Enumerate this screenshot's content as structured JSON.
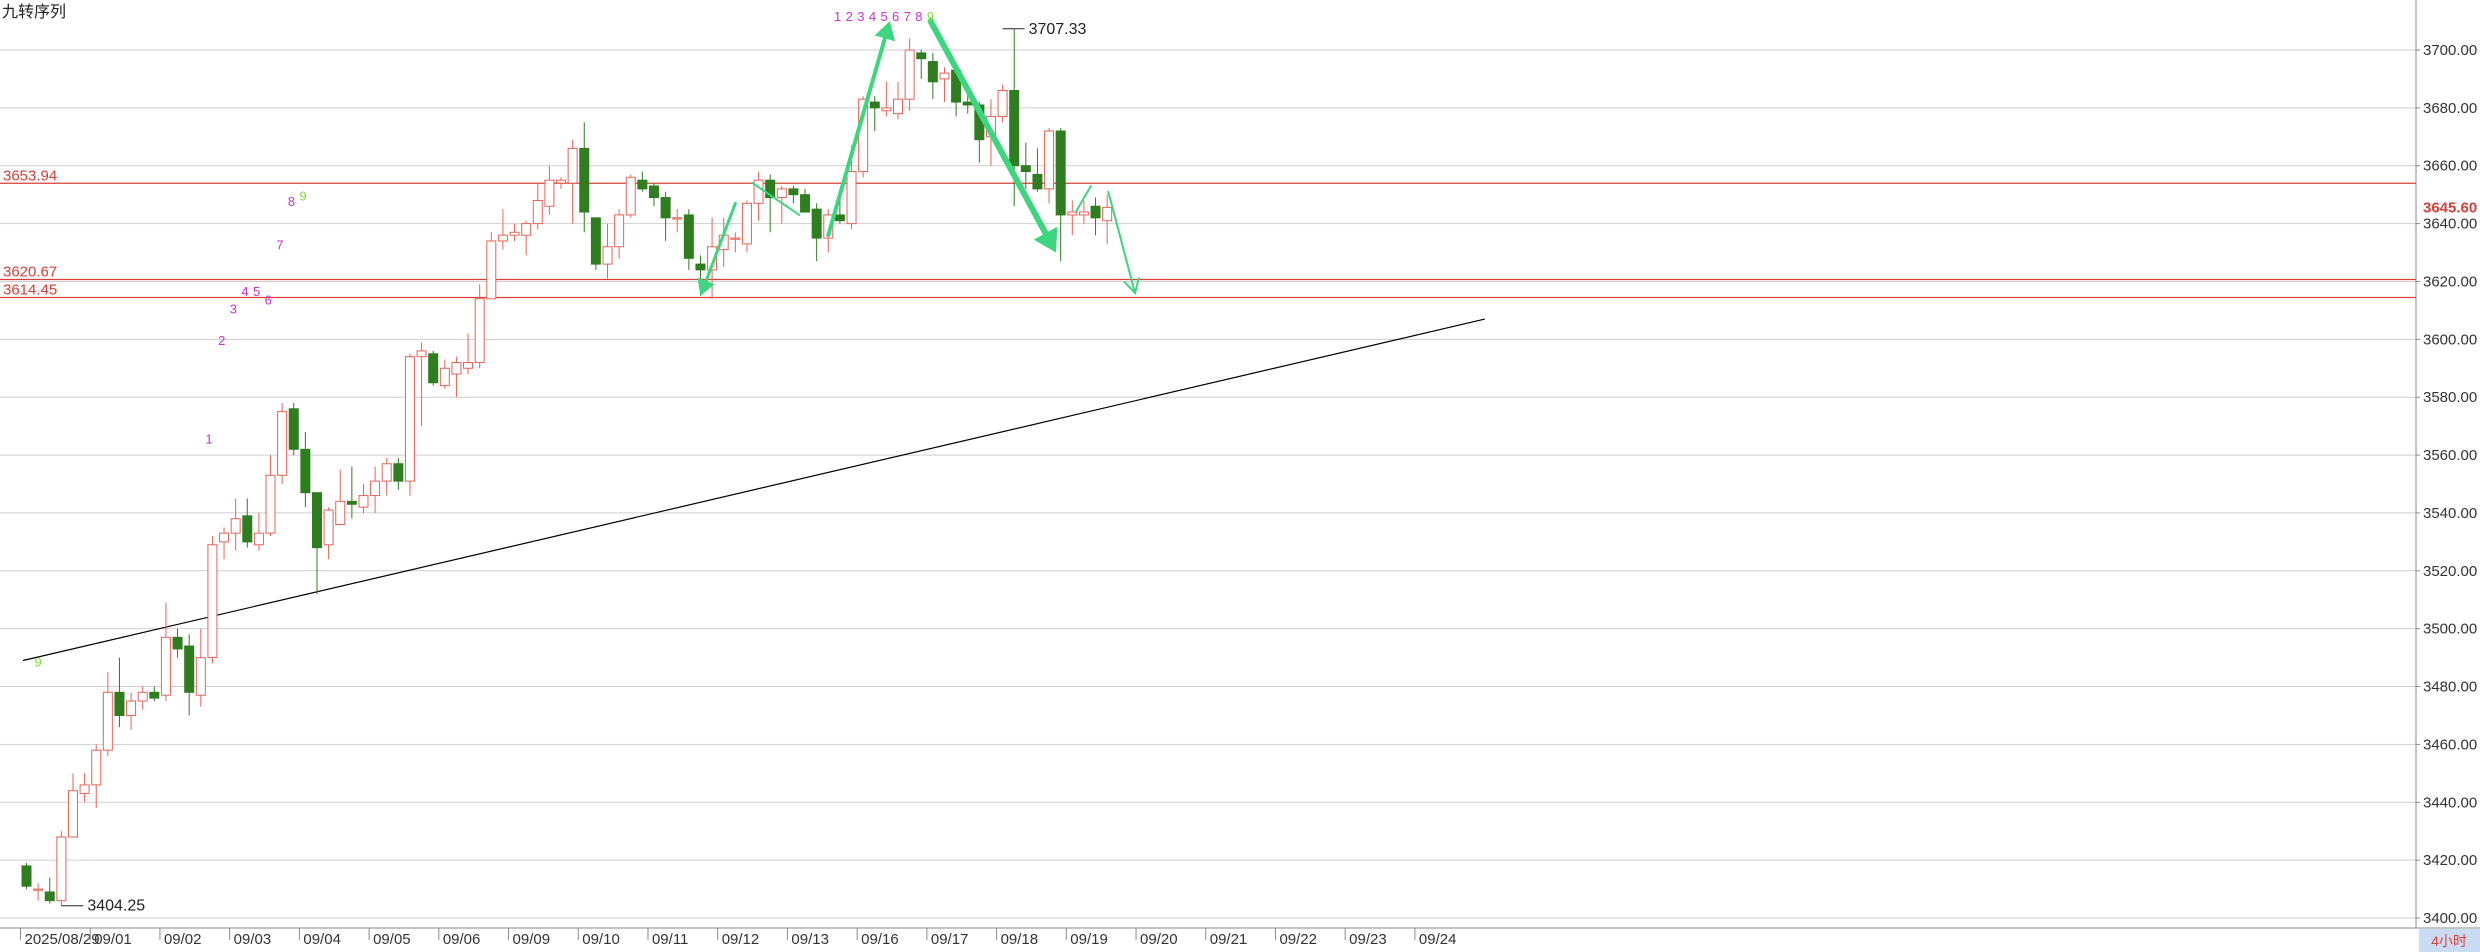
{
  "indicator_name": "九转序列",
  "colors": {
    "up": "#e8635a",
    "down": "#2e7d1f",
    "level_line": "#d9403a",
    "level_label": "#d9403a",
    "trend_line": "#000000",
    "arrow": "#3cd67f",
    "td_setup": "#cc33cc",
    "td_nine": "#7dde3a",
    "grid": "#cfcfcf",
    "axis_text": "#333333",
    "last_price_label": "#d9403a",
    "period_badge_bg": "#c9dcf3",
    "period_badge_text": "#d9403a"
  },
  "chart_data": {
    "type": "candlestick",
    "y_axis": {
      "min": 3400,
      "max": 3700,
      "ticks": [
        "3400.00",
        "3420.00",
        "3440.00",
        "3460.00",
        "3480.00",
        "3500.00",
        "3520.00",
        "3540.00",
        "3560.00",
        "3580.00",
        "3600.00",
        "3620.00",
        "3640.00",
        "3660.00",
        "3680.00",
        "3700.00"
      ]
    },
    "x_axis": {
      "labels": [
        {
          "text": "2025/08/29",
          "index": 0
        },
        {
          "text": "09/01",
          "index": 6
        },
        {
          "text": "09/02",
          "index": 12
        },
        {
          "text": "09/03",
          "index": 18
        },
        {
          "text": "09/04",
          "index": 24
        },
        {
          "text": "09/05",
          "index": 30
        },
        {
          "text": "09/06",
          "index": 36
        },
        {
          "text": "09/09",
          "index": 42
        },
        {
          "text": "09/10",
          "index": 48
        },
        {
          "text": "09/11",
          "index": 54
        },
        {
          "text": "09/12",
          "index": 60
        },
        {
          "text": "09/13",
          "index": 66
        },
        {
          "text": "09/16",
          "index": 72
        },
        {
          "text": "09/17",
          "index": 78
        },
        {
          "text": "09/18",
          "index": 84
        },
        {
          "text": "09/19",
          "index": 90
        },
        {
          "text": "09/20",
          "index": 96
        },
        {
          "text": "09/21",
          "index": 102
        },
        {
          "text": "09/22",
          "index": 108
        },
        {
          "text": "09/23",
          "index": 114
        },
        {
          "text": "09/24",
          "index": 120
        }
      ]
    },
    "candles": [
      {
        "o": 3418,
        "h": 3419,
        "l": 3410,
        "c": 3411
      },
      {
        "o": 3410,
        "h": 3412,
        "l": 3406,
        "c": 3410
      },
      {
        "o": 3409,
        "h": 3414,
        "l": 3405,
        "c": 3406
      },
      {
        "o": 3406,
        "h": 3430,
        "l": 3404.25,
        "c": 3428
      },
      {
        "o": 3428,
        "h": 3450,
        "l": 3428,
        "c": 3444
      },
      {
        "o": 3443,
        "h": 3450,
        "l": 3440,
        "c": 3446
      },
      {
        "o": 3446,
        "h": 3460,
        "l": 3438,
        "c": 3458
      },
      {
        "o": 3458,
        "h": 3485,
        "l": 3456,
        "c": 3478
      },
      {
        "o": 3478,
        "h": 3490,
        "l": 3466,
        "c": 3470
      },
      {
        "o": 3470,
        "h": 3478,
        "l": 3465,
        "c": 3475
      },
      {
        "o": 3475,
        "h": 3480,
        "l": 3472,
        "c": 3478
      },
      {
        "o": 3478,
        "h": 3480,
        "l": 3475,
        "c": 3476
      },
      {
        "o": 3477,
        "h": 3509,
        "l": 3475,
        "c": 3497
      },
      {
        "o": 3497,
        "h": 3500,
        "l": 3490,
        "c": 3493
      },
      {
        "o": 3494,
        "h": 3498,
        "l": 3470,
        "c": 3478
      },
      {
        "o": 3477,
        "h": 3500,
        "l": 3473,
        "c": 3490
      },
      {
        "o": 3490,
        "h": 3532,
        "l": 3488,
        "c": 3529
      },
      {
        "o": 3530,
        "h": 3535,
        "l": 3524,
        "c": 3533
      },
      {
        "o": 3533,
        "h": 3545,
        "l": 3527,
        "c": 3538
      },
      {
        "o": 3539,
        "h": 3545,
        "l": 3528,
        "c": 3530
      },
      {
        "o": 3529,
        "h": 3540,
        "l": 3527,
        "c": 3533
      },
      {
        "o": 3533,
        "h": 3560,
        "l": 3532,
        "c": 3553
      },
      {
        "o": 3553,
        "h": 3578,
        "l": 3550,
        "c": 3575
      },
      {
        "o": 3576,
        "h": 3578,
        "l": 3560,
        "c": 3562
      },
      {
        "o": 3562,
        "h": 3568,
        "l": 3542,
        "c": 3547
      },
      {
        "o": 3547,
        "h": 3547,
        "l": 3512,
        "c": 3528
      },
      {
        "o": 3529,
        "h": 3542,
        "l": 3524,
        "c": 3541
      },
      {
        "o": 3536,
        "h": 3555,
        "l": 3536,
        "c": 3544
      },
      {
        "o": 3544,
        "h": 3556,
        "l": 3538,
        "c": 3543
      },
      {
        "o": 3542,
        "h": 3550,
        "l": 3540,
        "c": 3546
      },
      {
        "o": 3546,
        "h": 3556,
        "l": 3540,
        "c": 3551
      },
      {
        "o": 3551,
        "h": 3559,
        "l": 3546,
        "c": 3557
      },
      {
        "o": 3557,
        "h": 3559,
        "l": 3548,
        "c": 3551
      },
      {
        "o": 3551,
        "h": 3595,
        "l": 3546,
        "c": 3594
      },
      {
        "o": 3594,
        "h": 3599,
        "l": 3570,
        "c": 3596
      },
      {
        "o": 3595,
        "h": 3596,
        "l": 3584,
        "c": 3585
      },
      {
        "o": 3584,
        "h": 3593,
        "l": 3583,
        "c": 3590
      },
      {
        "o": 3588,
        "h": 3594,
        "l": 3580,
        "c": 3592
      },
      {
        "o": 3590,
        "h": 3602,
        "l": 3588,
        "c": 3592
      },
      {
        "o": 3592,
        "h": 3619,
        "l": 3590,
        "c": 3614
      },
      {
        "o": 3614,
        "h": 3637,
        "l": 3614,
        "c": 3634
      },
      {
        "o": 3634,
        "h": 3645,
        "l": 3631,
        "c": 3636
      },
      {
        "o": 3636,
        "h": 3640,
        "l": 3634,
        "c": 3637
      },
      {
        "o": 3636,
        "h": 3641,
        "l": 3629,
        "c": 3640
      },
      {
        "o": 3640,
        "h": 3654,
        "l": 3638,
        "c": 3648
      },
      {
        "o": 3646,
        "h": 3660,
        "l": 3643,
        "c": 3655
      },
      {
        "o": 3654,
        "h": 3656,
        "l": 3652,
        "c": 3655
      },
      {
        "o": 3654,
        "h": 3669,
        "l": 3640,
        "c": 3666
      },
      {
        "o": 3666,
        "h": 3675,
        "l": 3637,
        "c": 3644
      },
      {
        "o": 3642,
        "h": 3642,
        "l": 3624,
        "c": 3626
      },
      {
        "o": 3626,
        "h": 3640,
        "l": 3621,
        "c": 3632
      },
      {
        "o": 3632,
        "h": 3645,
        "l": 3628,
        "c": 3643
      },
      {
        "o": 3643,
        "h": 3657,
        "l": 3642,
        "c": 3656
      },
      {
        "o": 3655,
        "h": 3658,
        "l": 3651,
        "c": 3652
      },
      {
        "o": 3653,
        "h": 3654,
        "l": 3646,
        "c": 3649
      },
      {
        "o": 3649,
        "h": 3651,
        "l": 3634,
        "c": 3642
      },
      {
        "o": 3642,
        "h": 3645,
        "l": 3637,
        "c": 3642
      },
      {
        "o": 3643,
        "h": 3645,
        "l": 3624,
        "c": 3628
      },
      {
        "o": 3626,
        "h": 3629,
        "l": 3615,
        "c": 3624
      },
      {
        "o": 3624,
        "h": 3642,
        "l": 3614,
        "c": 3632
      },
      {
        "o": 3631,
        "h": 3642,
        "l": 3625,
        "c": 3636
      },
      {
        "o": 3635,
        "h": 3637,
        "l": 3630,
        "c": 3635
      },
      {
        "o": 3633,
        "h": 3648,
        "l": 3630,
        "c": 3647
      },
      {
        "o": 3647,
        "h": 3658,
        "l": 3641,
        "c": 3655
      },
      {
        "o": 3655,
        "h": 3657,
        "l": 3637,
        "c": 3649
      },
      {
        "o": 3649,
        "h": 3653,
        "l": 3640,
        "c": 3652
      },
      {
        "o": 3652,
        "h": 3653,
        "l": 3647,
        "c": 3650
      },
      {
        "o": 3650,
        "h": 3652,
        "l": 3644,
        "c": 3644
      },
      {
        "o": 3645,
        "h": 3647,
        "l": 3627,
        "c": 3635
      },
      {
        "o": 3635,
        "h": 3645,
        "l": 3630,
        "c": 3643
      },
      {
        "o": 3643,
        "h": 3652,
        "l": 3640,
        "c": 3641
      },
      {
        "o": 3640,
        "h": 3667,
        "l": 3638,
        "c": 3658
      },
      {
        "o": 3658,
        "h": 3684,
        "l": 3656,
        "c": 3683
      },
      {
        "o": 3682,
        "h": 3684,
        "l": 3672,
        "c": 3680
      },
      {
        "o": 3679,
        "h": 3689,
        "l": 3677,
        "c": 3680
      },
      {
        "o": 3678,
        "h": 3689,
        "l": 3676,
        "c": 3683
      },
      {
        "o": 3683,
        "h": 3704,
        "l": 3679,
        "c": 3700
      },
      {
        "o": 3699,
        "h": 3700,
        "l": 3690,
        "c": 3697
      },
      {
        "o": 3696,
        "h": 3699,
        "l": 3683,
        "c": 3689
      },
      {
        "o": 3690,
        "h": 3694,
        "l": 3682,
        "c": 3692
      },
      {
        "o": 3693,
        "h": 3694,
        "l": 3677,
        "c": 3682
      },
      {
        "o": 3682,
        "h": 3687,
        "l": 3678,
        "c": 3681
      },
      {
        "o": 3681,
        "h": 3682,
        "l": 3661,
        "c": 3669
      },
      {
        "o": 3670,
        "h": 3683,
        "l": 3660,
        "c": 3677
      },
      {
        "o": 3677,
        "h": 3688,
        "l": 3675,
        "c": 3686
      },
      {
        "o": 3686,
        "h": 3707.33,
        "l": 3646,
        "c": 3660
      },
      {
        "o": 3660,
        "h": 3668,
        "l": 3652,
        "c": 3658
      },
      {
        "o": 3657,
        "h": 3666,
        "l": 3651,
        "c": 3652
      },
      {
        "o": 3652,
        "h": 3673,
        "l": 3647,
        "c": 3672
      },
      {
        "o": 3672,
        "h": 3673,
        "l": 3627,
        "c": 3643
      },
      {
        "o": 3643,
        "h": 3648,
        "l": 3636,
        "c": 3644
      },
      {
        "o": 3643,
        "h": 3648,
        "l": 3640,
        "c": 3644
      },
      {
        "o": 3646,
        "h": 3649,
        "l": 3636,
        "c": 3642
      },
      {
        "o": 3641,
        "h": 3650,
        "l": 3633,
        "c": 3645.6
      }
    ],
    "horizontal_levels": [
      {
        "label": "3653.94",
        "value": 3653.94
      },
      {
        "label": "3620.67",
        "value": 3620.67
      },
      {
        "label": "3614.45",
        "value": 3614.45
      }
    ],
    "trend_line": {
      "from": {
        "index": -0.3,
        "value": 3489
      },
      "to": {
        "index": 125.5,
        "value": 3607
      }
    },
    "extreme_labels": [
      {
        "text": "3404.25",
        "index": 3,
        "value": 3404.25,
        "kind": "low"
      },
      {
        "text": "3707.33",
        "index": 84,
        "value": 3707.33,
        "kind": "high"
      }
    ],
    "last_price": {
      "text": "3645.60",
      "value": 3645.6
    },
    "td_sequence": [
      {
        "text": "9",
        "index": 1,
        "value": 3487,
        "nine": true
      },
      {
        "text": "1",
        "index": 15.7,
        "value": 3564
      },
      {
        "text": "2",
        "index": 16.8,
        "value": 3598
      },
      {
        "text": "3",
        "index": 17.8,
        "value": 3609
      },
      {
        "text": "4",
        "index": 18.8,
        "value": 3615
      },
      {
        "text": "5",
        "index": 19.8,
        "value": 3615
      },
      {
        "text": "6",
        "index": 20.8,
        "value": 3612
      },
      {
        "text": "7",
        "index": 21.8,
        "value": 3631
      },
      {
        "text": "8",
        "index": 22.8,
        "value": 3646
      },
      {
        "text": "9",
        "index": 23.8,
        "value": 3648,
        "nine": true
      },
      {
        "text": "1",
        "index": 69.8,
        "value": 3710
      },
      {
        "text": "2",
        "index": 70.8,
        "value": 3710
      },
      {
        "text": "3",
        "index": 71.8,
        "value": 3710
      },
      {
        "text": "4",
        "index": 72.8,
        "value": 3710
      },
      {
        "text": "5",
        "index": 73.8,
        "value": 3710
      },
      {
        "text": "6",
        "index": 74.8,
        "value": 3710
      },
      {
        "text": "7",
        "index": 75.8,
        "value": 3710
      },
      {
        "text": "8",
        "index": 76.8,
        "value": 3710
      },
      {
        "text": "9",
        "index": 77.8,
        "value": 3710,
        "nine": true
      }
    ],
    "arrows": [
      {
        "from": {
          "index": 61,
          "value": 3647
        },
        "to": {
          "index": 58,
          "value": 3615
        },
        "head": "filled",
        "weight": 3
      },
      {
        "from": {
          "index": 62.5,
          "value": 3654
        },
        "to": {
          "index": 66.5,
          "value": 3643
        },
        "head": "none",
        "weight": 2
      },
      {
        "from": {
          "index": 69,
          "value": 3636
        },
        "to": {
          "index": 74.3,
          "value": 3710
        },
        "head": "filled",
        "weight": 4
      },
      {
        "from": {
          "index": 77.8,
          "value": 3710
        },
        "to": {
          "index": 88.6,
          "value": 3630
        },
        "head": "filled",
        "weight": 6
      },
      {
        "from": {
          "index": 90.3,
          "value": 3644
        },
        "to": {
          "index": 91.6,
          "value": 3653
        },
        "head": "none",
        "weight": 2
      },
      {
        "from": {
          "index": 93.1,
          "value": 3651
        },
        "to": {
          "index": 95.4,
          "value": 3616
        },
        "head": "open",
        "weight": 2
      }
    ],
    "period_badge": "4小时"
  }
}
